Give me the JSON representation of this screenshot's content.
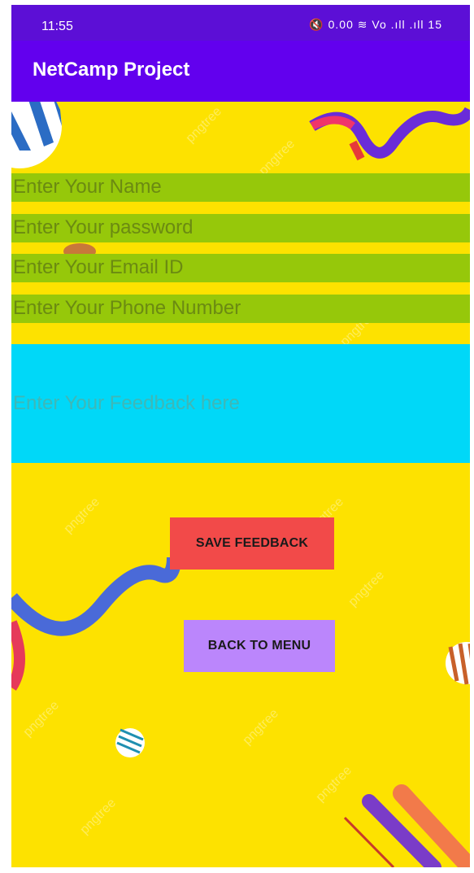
{
  "status_bar": {
    "time": "11:55",
    "indicators": "⚡ 0.00 ▼ Vo LTE .ıll .ıll 15",
    "battery": "15"
  },
  "app_bar": {
    "title": "NetCamp Project"
  },
  "form": {
    "name_placeholder": "Enter Your Name",
    "password_placeholder": "Enter Your password",
    "email_placeholder": "Enter Your Email ID",
    "phone_placeholder": "Enter Your Phone Number",
    "feedback_placeholder": "Enter Your Feedback here"
  },
  "buttons": {
    "save_label": "SAVE FEEDBACK",
    "back_label": "BACK TO MENU"
  },
  "colors": {
    "status_bar": "#5c0fd6",
    "app_bar": "#6200ee",
    "background": "#fde200",
    "input": "#96c80a",
    "feedback": "#00d8f8",
    "save": "#f24a49",
    "back": "#bb86fc"
  },
  "watermark": "pngtree"
}
